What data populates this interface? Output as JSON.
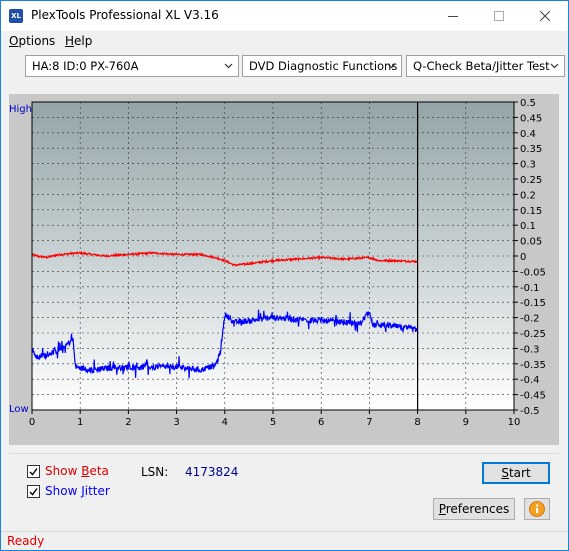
{
  "window": {
    "title": "PlexTools Professional XL V3.16",
    "icon_text": "XL",
    "icon": "plextools-logo-icon"
  },
  "menu": [
    {
      "accel": "O",
      "rest": "ptions"
    },
    {
      "accel": "H",
      "rest": "elp"
    }
  ],
  "toolbar": {
    "drive": "HA:8 ID:0  PX-760A",
    "function": "DVD Diagnostic Functions",
    "test": "Q-Check Beta/Jitter Test"
  },
  "chart": {
    "left_label_high": "High",
    "left_label_low": "Low"
  },
  "chart_data": {
    "type": "line",
    "title": "",
    "xlabel": "",
    "ylabel": "",
    "xlim": [
      0,
      10
    ],
    "ylim": [
      -0.5,
      0.5
    ],
    "grid": true,
    "x_ticks": [
      "0",
      "1",
      "2",
      "3",
      "4",
      "5",
      "6",
      "7",
      "8",
      "9",
      "10"
    ],
    "y_ticks": [
      "0.5",
      "0.45",
      "0.4",
      "0.35",
      "0.3",
      "0.25",
      "0.2",
      "0.15",
      "0.1",
      "0.05",
      "0",
      "-0.05",
      "-0.1",
      "-0.15",
      "-0.2",
      "-0.25",
      "-0.3",
      "-0.35",
      "-0.4",
      "-0.45",
      "-0.5"
    ],
    "marker_x": 8.0,
    "series": [
      {
        "color": "#ff0000",
        "x": [
          0,
          0.1,
          0.3,
          0.5,
          0.8,
          1.0,
          1.5,
          2.0,
          2.5,
          3.0,
          3.5,
          3.8,
          4.0,
          4.2,
          4.5,
          5.0,
          5.5,
          6.0,
          6.5,
          7.0,
          7.2,
          7.5,
          8.0
        ],
        "y": [
          0.005,
          0.0,
          -0.005,
          0.003,
          0.008,
          0.01,
          0.0,
          0.005,
          0.01,
          0.005,
          0.005,
          -0.005,
          -0.015,
          -0.03,
          -0.025,
          -0.015,
          -0.01,
          -0.005,
          -0.01,
          -0.005,
          -0.015,
          -0.015,
          -0.018
        ]
      },
      {
        "color": "#0000ff",
        "x": [
          0,
          0.1,
          0.3,
          0.5,
          0.7,
          0.85,
          0.9,
          1.2,
          1.5,
          2.0,
          2.5,
          3.0,
          3.5,
          3.8,
          3.9,
          4.0,
          4.2,
          4.5,
          5.0,
          5.5,
          6.0,
          6.5,
          6.8,
          7.0,
          7.05,
          7.3,
          7.6,
          8.0
        ],
        "y": [
          -0.3,
          -0.33,
          -0.32,
          -0.31,
          -0.29,
          -0.27,
          -0.36,
          -0.37,
          -0.365,
          -0.36,
          -0.36,
          -0.36,
          -0.37,
          -0.355,
          -0.32,
          -0.19,
          -0.215,
          -0.21,
          -0.2,
          -0.205,
          -0.21,
          -0.215,
          -0.22,
          -0.18,
          -0.225,
          -0.225,
          -0.23,
          -0.24
        ]
      }
    ]
  },
  "options": {
    "show_beta_accel": "B",
    "show_beta_pre": "Show ",
    "show_beta_post": "eta",
    "show_beta_checked": true,
    "show_beta_color": "#e00000",
    "show_jitter_accel": "J",
    "show_jitter_pre": "Show ",
    "show_jitter_post": "itter",
    "show_jitter_checked": true,
    "show_jitter_color": "#0000ff",
    "lsn_label": "LSN:",
    "lsn_value": "4173824"
  },
  "buttons": {
    "start_accel": "S",
    "start_rest": "tart",
    "prefs_accel": "P",
    "prefs_rest": "references",
    "info_icon": "info-icon"
  },
  "status": {
    "text": "Ready",
    "color": "#e00000"
  }
}
